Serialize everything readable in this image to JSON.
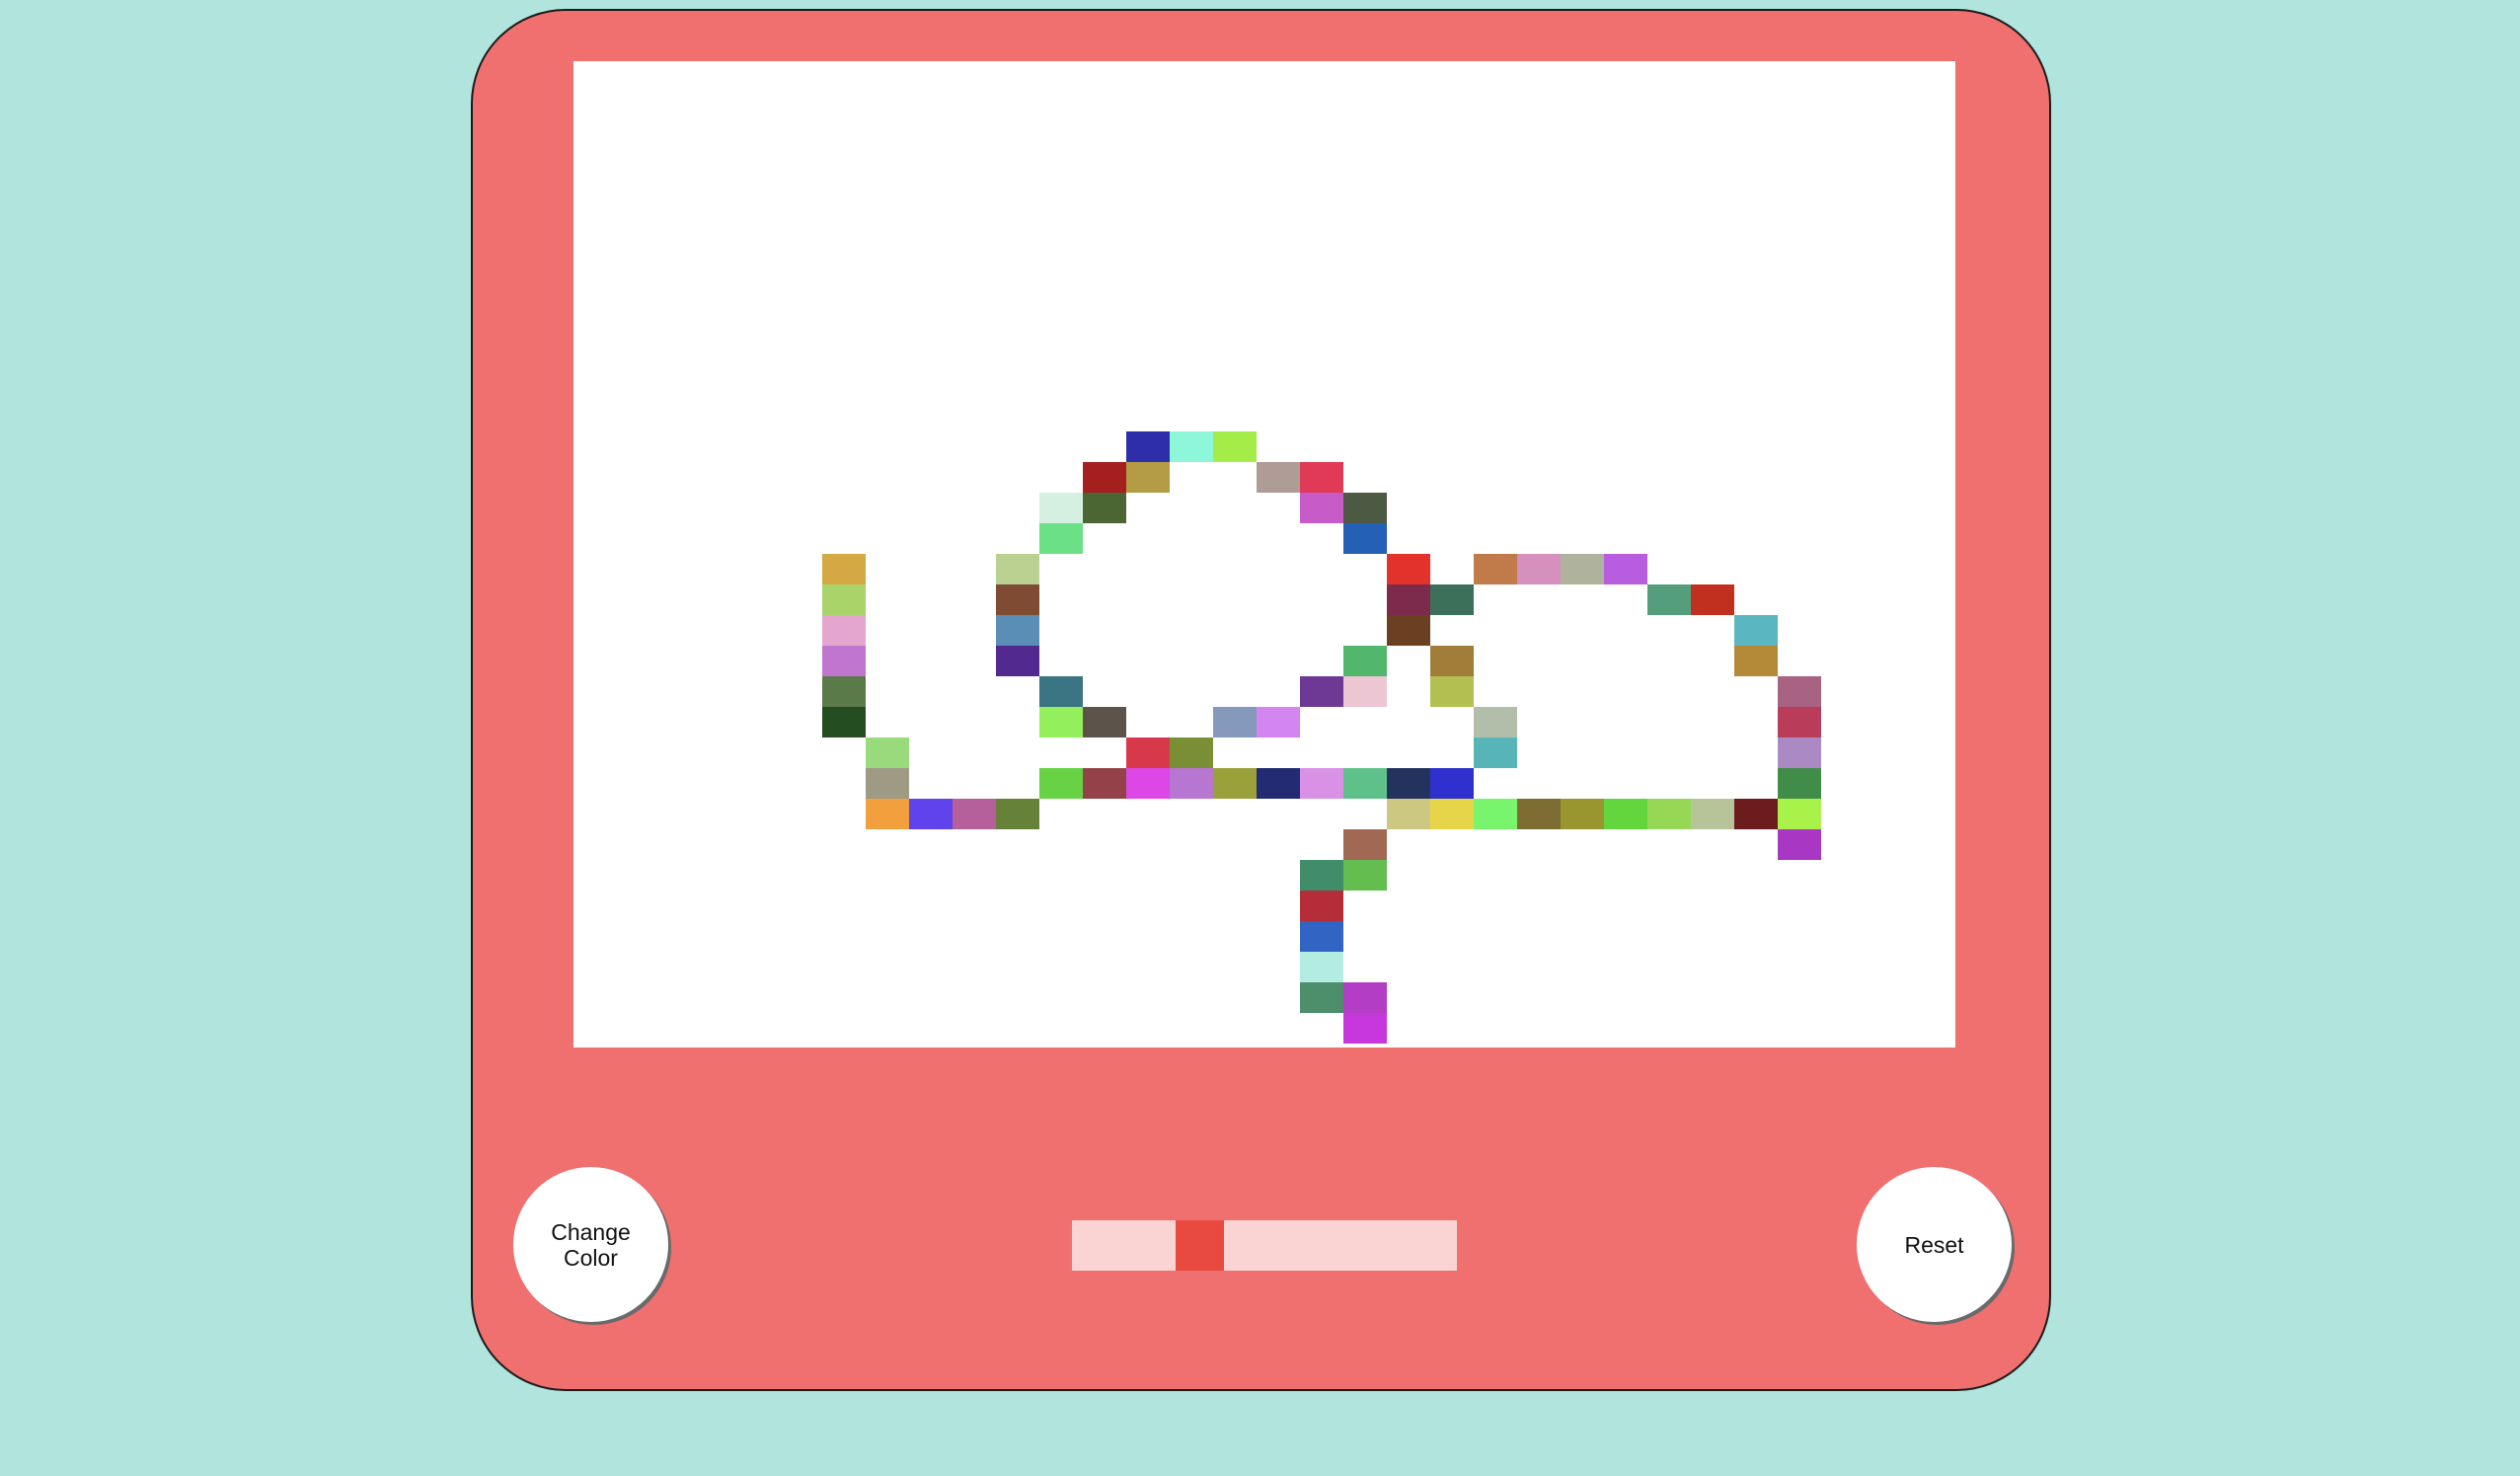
{
  "colors": {
    "background": "#b0e4dd",
    "frame": "#ef706f",
    "screen": "#ffffff",
    "slider_thumb": "#e84a3f"
  },
  "controls": {
    "change_color_label": "Change\nColor",
    "reset_label": "Reset"
  },
  "slider": {
    "value": 0.27
  },
  "drawing": {
    "grid_cell": "44x31",
    "pixels": [
      {
        "c": 3,
        "r": 1,
        "color": "#d4a843"
      },
      {
        "c": 3,
        "r": 2,
        "color": "#a8d46a"
      },
      {
        "c": 3,
        "r": 3,
        "color": "#e4a6cf"
      },
      {
        "c": 3,
        "r": 4,
        "color": "#c075cf"
      },
      {
        "c": 3,
        "r": 5,
        "color": "#5b7a49"
      },
      {
        "c": 3,
        "r": 6,
        "color": "#244d22"
      },
      {
        "c": 4,
        "r": 7,
        "color": "#99da7c"
      },
      {
        "c": 4,
        "r": 8,
        "color": "#9e9a84"
      },
      {
        "c": 4,
        "r": 9,
        "color": "#f29f3e"
      },
      {
        "c": 5,
        "r": 9,
        "color": "#6043ec"
      },
      {
        "c": 6,
        "r": 9,
        "color": "#b5609a"
      },
      {
        "c": 7,
        "r": 9,
        "color": "#668239"
      },
      {
        "c": 8,
        "r": 8,
        "color": "#67d244"
      },
      {
        "c": 9,
        "r": 8,
        "color": "#944249"
      },
      {
        "c": 10,
        "r": 8,
        "color": "#dc48e6"
      },
      {
        "c": 11,
        "r": 8,
        "color": "#b776d2"
      },
      {
        "c": 12,
        "r": 8,
        "color": "#9aa03a"
      },
      {
        "c": 13,
        "r": 8,
        "color": "#232b73"
      },
      {
        "c": 14,
        "r": 8,
        "color": "#d991e5"
      },
      {
        "c": 15,
        "r": 8,
        "color": "#5ec189"
      },
      {
        "c": 16,
        "r": 8,
        "color": "#24335e"
      },
      {
        "c": 16,
        "r": 9,
        "color": "#cdc881"
      },
      {
        "c": 17,
        "r": 9,
        "color": "#72f0e8"
      },
      {
        "c": 18,
        "r": 9,
        "color": "#78f46d"
      },
      {
        "c": 19,
        "r": 9,
        "color": "#7e6d33"
      },
      {
        "c": 20,
        "r": 9,
        "color": "#999630"
      },
      {
        "c": 21,
        "r": 9,
        "color": "#63d63d"
      },
      {
        "c": 22,
        "r": 9,
        "color": "#96d855"
      },
      {
        "c": 23,
        "r": 9,
        "color": "#b7c49a"
      },
      {
        "c": 24,
        "r": 9,
        "color": "#6d1c1d"
      },
      {
        "c": 15,
        "r": 10,
        "color": "#a16853"
      },
      {
        "c": 14,
        "r": 11,
        "color": "#418d69"
      },
      {
        "c": 15,
        "r": 11,
        "color": "#63bd4f"
      },
      {
        "c": 14,
        "r": 12,
        "color": "#b52d38"
      },
      {
        "c": 14,
        "r": 13,
        "color": "#3164c3"
      },
      {
        "c": 14,
        "r": 14,
        "color": "#b3ece1"
      },
      {
        "c": 14,
        "r": 15,
        "color": "#4d8e6b"
      },
      {
        "c": 15,
        "r": 15,
        "color": "#b33dc4"
      },
      {
        "c": 15,
        "r": 16,
        "color": "#c637dc"
      },
      {
        "c": 10,
        "r": -3,
        "color": "#2e2eab"
      },
      {
        "c": 11,
        "r": -3,
        "color": "#8ff7d9"
      },
      {
        "c": 12,
        "r": -3,
        "color": "#a4ec48"
      },
      {
        "c": 9,
        "r": -2,
        "color": "#a61f1f"
      },
      {
        "c": 10,
        "r": -2,
        "color": "#b39c45"
      },
      {
        "c": 13,
        "r": -2,
        "color": "#b09c96"
      },
      {
        "c": 14,
        "r": -2,
        "color": "#e13a57"
      },
      {
        "c": 8,
        "r": -1,
        "color": "#d5efe1"
      },
      {
        "c": 9,
        "r": -1,
        "color": "#4b6533"
      },
      {
        "c": 14,
        "r": -1,
        "color": "#c75bc8"
      },
      {
        "c": 15,
        "r": -1,
        "color": "#4c5a44"
      },
      {
        "c": 8,
        "r": 0,
        "color": "#6ce087"
      },
      {
        "c": 15,
        "r": 0,
        "color": "#2560b7"
      },
      {
        "c": 7,
        "r": 1,
        "color": "#bbd191"
      },
      {
        "c": 16,
        "r": 1,
        "color": "#e3322b"
      },
      {
        "c": 7,
        "r": 2,
        "color": "#7f4b33"
      },
      {
        "c": 16,
        "r": 2,
        "color": "#7d2b4c"
      },
      {
        "c": 7,
        "r": 3,
        "color": "#5b8eb6"
      },
      {
        "c": 16,
        "r": 3,
        "color": "#6b4021"
      },
      {
        "c": 7,
        "r": 4,
        "color": "#52298e"
      },
      {
        "c": 15,
        "r": 4,
        "color": "#52b76c"
      },
      {
        "c": 8,
        "r": 5,
        "color": "#3b7482"
      },
      {
        "c": 14,
        "r": 5,
        "color": "#6e3895"
      },
      {
        "c": 15,
        "r": 5,
        "color": "#ecc6d3"
      },
      {
        "c": 8,
        "r": 6,
        "color": "#94ef5c"
      },
      {
        "c": 9,
        "r": 6,
        "color": "#5c544b"
      },
      {
        "c": 12,
        "r": 6,
        "color": "#8599bc"
      },
      {
        "c": 13,
        "r": 6,
        "color": "#d385f0"
      },
      {
        "c": 10,
        "r": 7,
        "color": "#d8394a"
      },
      {
        "c": 11,
        "r": 7,
        "color": "#7a8e36"
      },
      {
        "c": 17,
        "r": 2,
        "color": "#3d705a"
      },
      {
        "c": 18,
        "r": 1,
        "color": "#c17a4a"
      },
      {
        "c": 19,
        "r": 1,
        "color": "#d590bd"
      },
      {
        "c": 20,
        "r": 1,
        "color": "#afb39e"
      },
      {
        "c": 21,
        "r": 1,
        "color": "#b85ce0"
      },
      {
        "c": 22,
        "r": 2,
        "color": "#549e7c"
      },
      {
        "c": 23,
        "r": 2,
        "color": "#c1301f"
      },
      {
        "c": 24,
        "r": 3,
        "color": "#5ab6c1"
      },
      {
        "c": 24,
        "r": 4,
        "color": "#b48a39"
      },
      {
        "c": 25,
        "r": 5,
        "color": "#a86282"
      },
      {
        "c": 25,
        "r": 6,
        "color": "#b93d5b"
      },
      {
        "c": 25,
        "r": 7,
        "color": "#ab8ac3"
      },
      {
        "c": 25,
        "r": 8,
        "color": "#428c4a"
      },
      {
        "c": 25,
        "r": 9,
        "color": "#a9f24a"
      },
      {
        "c": 25,
        "r": 10,
        "color": "#a838c4"
      },
      {
        "c": 17,
        "r": 4,
        "color": "#a07d38"
      },
      {
        "c": 17,
        "r": 5,
        "color": "#b3c051"
      },
      {
        "c": 18,
        "r": 6,
        "color": "#b2beaa"
      },
      {
        "c": 18,
        "r": 7,
        "color": "#57b5b7"
      },
      {
        "c": 17,
        "r": 8,
        "color": "#2f31cf"
      },
      {
        "c": 17,
        "r": 9,
        "color": "#e6d548"
      }
    ]
  }
}
